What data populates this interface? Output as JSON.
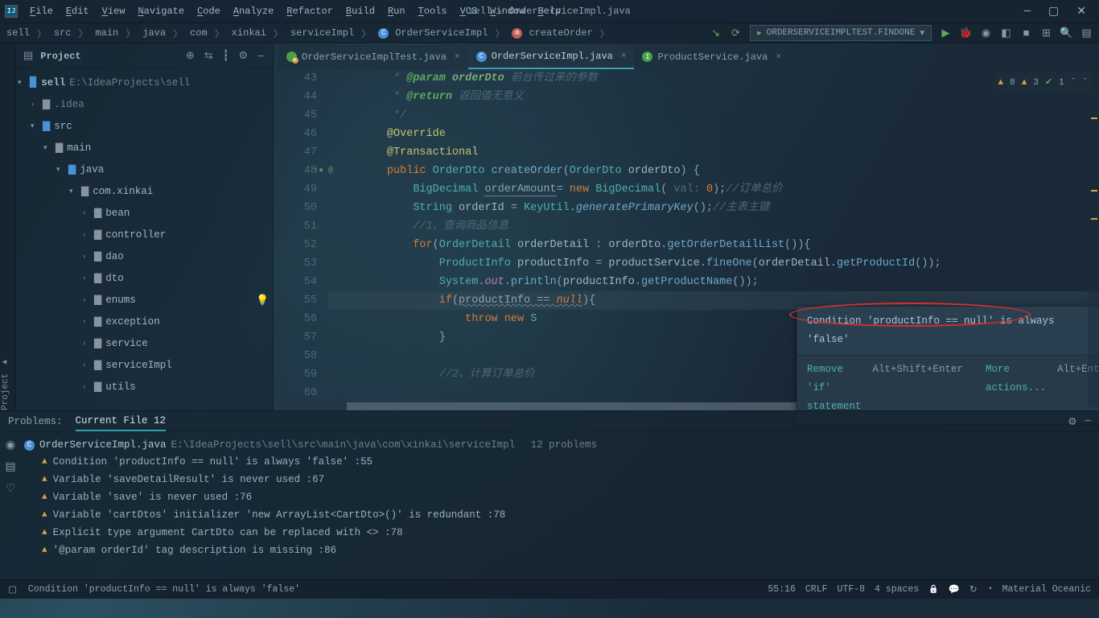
{
  "window": {
    "title": "sell - OrderServiceImpl.java"
  },
  "menus": [
    "File",
    "Edit",
    "View",
    "Navigate",
    "Code",
    "Analyze",
    "Refactor",
    "Build",
    "Run",
    "Tools",
    "VCS",
    "Window",
    "Help"
  ],
  "breadcrumbs": [
    "sell",
    "src",
    "main",
    "java",
    "com",
    "xinkai",
    "serviceImpl",
    "OrderServiceImpl",
    "createOrder"
  ],
  "run_config": "ORDERSERVICEIMPLTEST.FINDONE",
  "project": {
    "title": "Project",
    "root": {
      "name": "sell",
      "path": "E:\\IdeaProjects\\sell"
    },
    "nodes": [
      {
        "depth": 1,
        "open": false,
        "name": ".idea",
        "type": "folder-d"
      },
      {
        "depth": 1,
        "open": true,
        "name": "src",
        "type": "folder-b"
      },
      {
        "depth": 2,
        "open": true,
        "name": "main",
        "type": "folder"
      },
      {
        "depth": 3,
        "open": true,
        "name": "java",
        "type": "folder-b"
      },
      {
        "depth": 4,
        "open": true,
        "name": "com.xinkai",
        "type": "folder"
      },
      {
        "depth": 5,
        "open": false,
        "name": "bean",
        "type": "folder"
      },
      {
        "depth": 5,
        "open": false,
        "name": "controller",
        "type": "folder"
      },
      {
        "depth": 5,
        "open": false,
        "name": "dao",
        "type": "folder"
      },
      {
        "depth": 5,
        "open": false,
        "name": "dto",
        "type": "folder"
      },
      {
        "depth": 5,
        "open": false,
        "name": "enums",
        "type": "folder"
      },
      {
        "depth": 5,
        "open": false,
        "name": "exception",
        "type": "folder"
      },
      {
        "depth": 5,
        "open": false,
        "name": "service",
        "type": "folder"
      },
      {
        "depth": 5,
        "open": false,
        "name": "serviceImpl",
        "type": "folder"
      },
      {
        "depth": 5,
        "open": false,
        "name": "utils",
        "type": "folder"
      }
    ]
  },
  "tabs": [
    {
      "name": "OrderServiceImplTest.java",
      "active": false,
      "icon": "t"
    },
    {
      "name": "OrderServiceImpl.java",
      "active": true,
      "icon": "c"
    },
    {
      "name": "ProductService.java",
      "active": false,
      "icon": "i"
    }
  ],
  "inspect": {
    "warn_a": "8",
    "warn_b": "3",
    "ok": "1"
  },
  "gutter_start": 43,
  "code_lines": [
    {
      "n": 43,
      "html": "          <span class='cmt'>* </span><span class='kw-g'>@param</span><span class='kw-s'> orderDto</span> <span class='cmt'>前台传过来的参数</span>"
    },
    {
      "n": 44,
      "html": "          <span class='cmt'>* </span><span class='kw-g'>@return</span> <span class='cmt'>返回值无意义</span>"
    },
    {
      "n": 45,
      "html": "          <span class='cmt'>*/</span>"
    },
    {
      "n": 46,
      "html": "         <span class='kw-y'>@Override</span>"
    },
    {
      "n": 47,
      "html": "         <span class='kw-y'>@Transactional</span>"
    },
    {
      "n": 48,
      "html": "         <span class='kw-o'>public</span> <span class='kw-t'>OrderDto</span> <span class='kw-fn'>createOrder</span>(<span class='kw-t'>OrderDto</span> <span class='kw-id'>orderDto</span>) {",
      "mark": "↑● @"
    },
    {
      "n": 49,
      "html": "             <span class='kw-t'>BigDecimal</span> <span class='underl2'>orderAmount</span>= <span class='kw-o'>new</span> <span class='kw-t'>BigDecimal</span>( <span class='cmt2'>val:</span> <span class='kw-n'>0</span>);<span class='cmt'>//订单总价</span>"
    },
    {
      "n": 50,
      "html": "             <span class='kw-t'>String</span> <span class='kw-id'>orderId</span> = <span class='kw-t'>KeyUtil</span>.<span class='kw-fn' style='font-style:italic'>generatePrimaryKey</span>();<span class='cmt'>//主表主键</span>"
    },
    {
      "n": 51,
      "html": "             <span class='cmt'>//1、查询商品信息</span>"
    },
    {
      "n": 52,
      "html": "             <span class='kw-o'>for</span>(<span class='kw-t'>OrderDetail</span> <span class='kw-id'>orderDetail</span> : <span class='kw-id'>orderDto</span>.<span class='kw-fn'>getOrderDetailList</span>()){"
    },
    {
      "n": 53,
      "html": "                 <span class='kw-t'>ProductInfo</span> <span class='kw-id'>productInfo</span> = <span class='kw-id'>productService</span>.<span class='kw-fn'>fineOne</span>(<span class='kw-id'>orderDetail</span>.<span class='kw-fn'>getProductId</span>());"
    },
    {
      "n": 54,
      "html": "                 <span class='kw-t'>System</span>.<span class='kw-glbl'>out</span>.<span class='kw-fn'>println</span>(<span class='kw-id'>productInfo</span>.<span class='kw-fn'>getProductName</span>());"
    },
    {
      "n": 55,
      "html": "                 <span class='kw-o'>if</span>(<span class='underl'>productInfo == </span><span class='kw-o underl'><i>null</i></span>){",
      "hl": true,
      "bulb": true
    },
    {
      "n": 56,
      "html": "                     <span class='kw-o'>throw</span> <span class='kw-o'>new</span> <span class='kw-t'>S</span>"
    },
    {
      "n": 57,
      "html": "                 }"
    },
    {
      "n": 58,
      "html": "             "
    },
    {
      "n": 59,
      "html": "                 <span class='cmt'>//2、计算订单总价</span>"
    },
    {
      "n": 60,
      "html": "                 "
    }
  ],
  "hint": {
    "text": "Condition 'productInfo == null' is always 'false'",
    "fix": "Remove 'if' statement",
    "fix_sc": "Alt+Shift+Enter",
    "more": "More actions...",
    "more_sc": "Alt+Enter"
  },
  "problems": {
    "tab1": "Problems:",
    "tab2": "Current File",
    "count": "12",
    "file": "OrderServiceImpl.java",
    "path": "E:\\IdeaProjects\\sell\\src\\main\\java\\com\\xinkai\\serviceImpl",
    "summary": "12 problems",
    "issues": [
      "Condition 'productInfo == null' is always 'false' :55",
      "Variable 'saveDetailResult' is never used :67",
      "Variable 'save' is never used :76",
      "Variable 'cartDtos' initializer 'new ArrayList<CartDto>()' is redundant :78",
      "Explicit type argument CartDto can be replaced with <> :78",
      "'@param orderId' tag description is missing :86"
    ]
  },
  "status": {
    "msg": "Condition 'productInfo == null' is always 'false'",
    "pos": "55:16",
    "eol": "CRLF",
    "enc": "UTF-8",
    "indent": "4 spaces",
    "theme": "Material Oceanic"
  }
}
